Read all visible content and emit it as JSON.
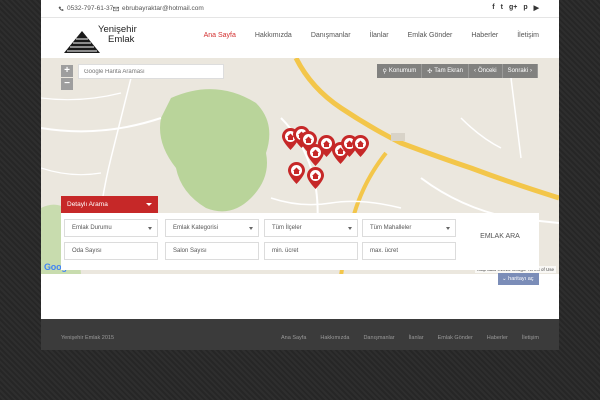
{
  "topbar": {
    "phone": "0532-797-61-37",
    "email": "ebrubayraktar@hotmail.com",
    "social": [
      "f",
      "t",
      "g+",
      "p",
      "yt"
    ]
  },
  "logo": {
    "line1": "Yenişehir",
    "line2": "Emlak"
  },
  "nav": [
    {
      "label": "Ana Sayfa",
      "active": true
    },
    {
      "label": "Hakkımızda"
    },
    {
      "label": "Danışmanlar"
    },
    {
      "label": "İlanlar"
    },
    {
      "label": "Emlak Gönder"
    },
    {
      "label": "Haberler"
    },
    {
      "label": "İletişim"
    }
  ],
  "map": {
    "zoom_in": "+",
    "zoom_out": "−",
    "search_placeholder": "Google Harita Araması",
    "controls": [
      "Konumum",
      "Tam Ekran",
      "Önceki",
      "Sonraki"
    ],
    "google": "Google",
    "attribution": "Map data ©2015 Google    Terms of Use"
  },
  "search": {
    "tab_label": "Detaylı Arama",
    "fields": [
      "Emlak Durumu",
      "Emlak Kategorisi",
      "Tüm İlçeler",
      "Tüm Mahalleler",
      "Oda Sayısı",
      "Salon Sayısı",
      "min. ücret",
      "max. ücret"
    ],
    "submit": "EMLAK ARA",
    "hide": "haritayı aç"
  },
  "footer": {
    "copyright": "Yenişehir Emlak 2015",
    "links": [
      "Ana Sayfa",
      "Hakkımızda",
      "Danışmanlar",
      "İlanlar",
      "Emlak Gönder",
      "Haberler",
      "İletişim"
    ]
  },
  "colors": {
    "accent": "#d32f2f",
    "footer_bg": "#3b3b3b"
  }
}
